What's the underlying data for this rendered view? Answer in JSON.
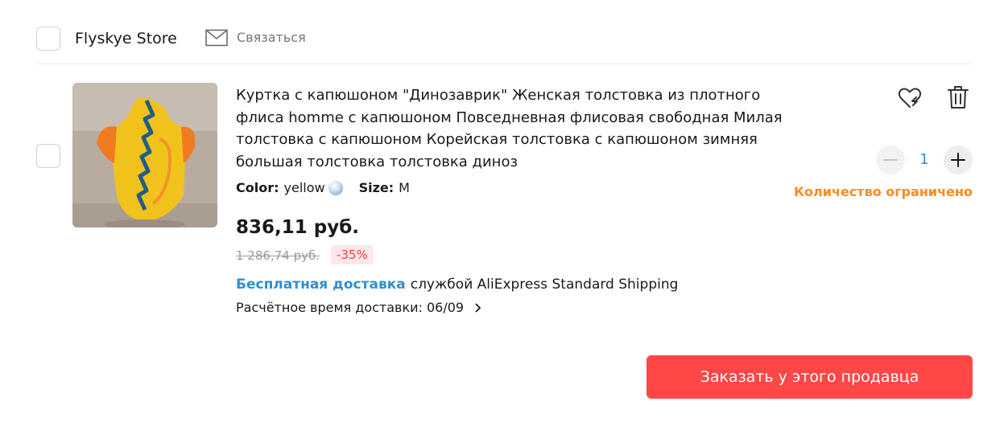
{
  "store": {
    "name": "Flyskye Store",
    "contact_label": "Связаться"
  },
  "item": {
    "title": "Куртка с капюшоном \"Динозаврик\" Женская толстовка из плотного флиса homme с капюшоном Повседневная флисовая свободная Милая толстовка с капюшоном Корейская толстовка с капюшоном зимняя большая толстовка толстовка диноз",
    "color_key": "Color:",
    "color_value": "yellow",
    "size_key": "Size:",
    "size_value": "M",
    "price": "836,11 руб.",
    "old_price": "1 286,74 руб.",
    "discount": "-35%",
    "shipping_free": "Бесплатная доставка",
    "shipping_method": "службой AliExpress Standard Shipping",
    "delivery_estimate": "Расчётное время доставки: 06/09",
    "quantity": "1",
    "limited_note": "Количество ограничено"
  },
  "actions": {
    "order_button": "Заказать у этого продавца"
  },
  "icons": {
    "contact": "envelope-icon",
    "wishlist": "heart-icon",
    "delete": "trash-icon",
    "decrease": "minus-icon",
    "increase": "plus-icon",
    "delivery_more": "chevron-right-icon"
  },
  "colors": {
    "accent_red": "#ff4747",
    "link_blue": "#2e8fd3",
    "warning_orange": "#fd8a1f",
    "discount_red": "#ff3b3b"
  }
}
